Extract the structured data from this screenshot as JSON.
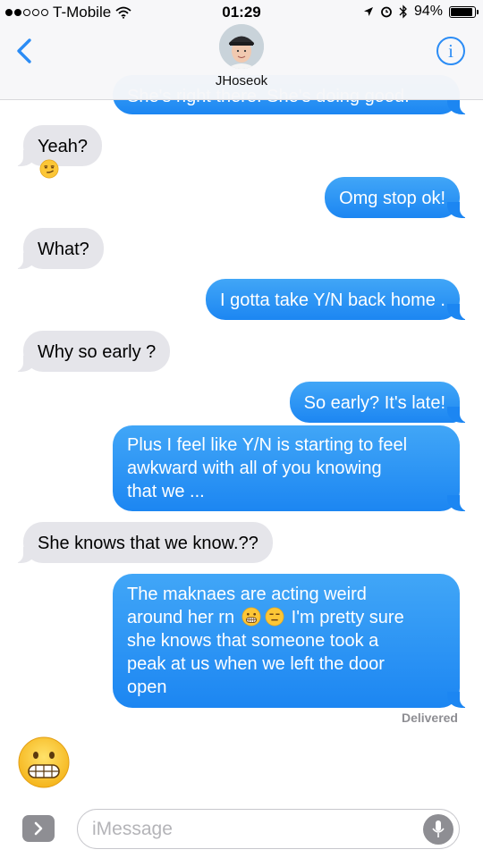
{
  "status_bar": {
    "carrier": "T-Mobile",
    "time": "01:29",
    "battery": "94%",
    "battery_level": 0.94,
    "signal_bars_filled": 2,
    "signal_bars_total": 5
  },
  "header": {
    "contact_name": "JHoseok",
    "info_symbol": "i",
    "back_icon": "chevron-left-icon"
  },
  "messages": [
    {
      "from": "me",
      "text": "She's right there. She's doing good."
    },
    {
      "from": "them",
      "text": "Yeah?",
      "emoji": "smirking-face"
    },
    {
      "from": "me",
      "text": "Omg stop ok!"
    },
    {
      "from": "them",
      "text": "What?"
    },
    {
      "from": "me",
      "text": "I gotta take Y/N back home ."
    },
    {
      "from": "them",
      "text": "Why so early ?"
    },
    {
      "from": "me",
      "text": "So early? It's late!"
    },
    {
      "from": "me",
      "text": "Plus I feel like Y/N is starting to feel\nawkward with all of you knowing\nthat we ..."
    },
    {
      "from": "them",
      "text": "She knows that we know.??"
    },
    {
      "from": "me",
      "text_before": "The maknaes are acting weird\naround her rn",
      "emojis": [
        "grimacing-face",
        "expressionless-face"
      ],
      "text_after": "I'm pretty sure\nshe knows that someone took a\npeak at us when we left the door\nopen"
    },
    {
      "from": "them",
      "emoji": "grimacing-face",
      "big": true
    }
  ],
  "delivered_label": "Delivered",
  "input": {
    "placeholder": "iMessage",
    "value": ""
  },
  "colors": {
    "sent_bubble": "#1c86f2",
    "received_bubble": "#e5e5ea",
    "accent": "#2b8cf5"
  }
}
